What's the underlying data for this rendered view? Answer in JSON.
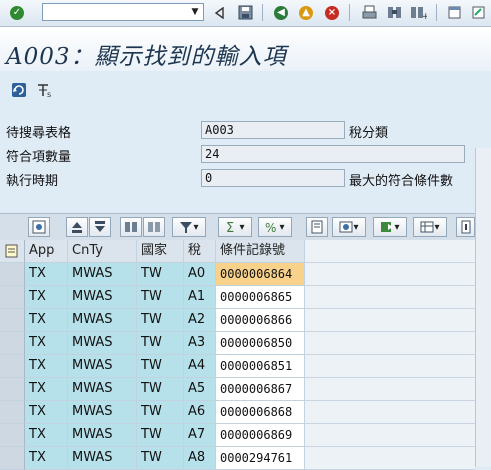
{
  "title": "A003：顯示找到的輸入項",
  "form": {
    "search_table_label": "待搜尋表格",
    "search_table_value": "A003",
    "search_table_desc": "稅分類",
    "hits_label": "符合項數量",
    "hits_value": "24",
    "exec_time_label": "執行時期",
    "exec_time_value": "0",
    "exec_time_desc": "最大的符合條件數"
  },
  "grid": {
    "headers": [
      "App",
      "CnTy",
      "國家",
      "稅",
      "條件記錄號"
    ],
    "rows": [
      [
        "TX",
        "MWAS",
        "TW",
        "A0",
        "0000006864"
      ],
      [
        "TX",
        "MWAS",
        "TW",
        "A1",
        "0000006865"
      ],
      [
        "TX",
        "MWAS",
        "TW",
        "A2",
        "0000006866"
      ],
      [
        "TX",
        "MWAS",
        "TW",
        "A3",
        "0000006850"
      ],
      [
        "TX",
        "MWAS",
        "TW",
        "A4",
        "0000006851"
      ],
      [
        "TX",
        "MWAS",
        "TW",
        "A5",
        "0000006867"
      ],
      [
        "TX",
        "MWAS",
        "TW",
        "A6",
        "0000006868"
      ],
      [
        "TX",
        "MWAS",
        "TW",
        "A7",
        "0000006869"
      ],
      [
        "TX",
        "MWAS",
        "TW",
        "A8",
        "0000294761"
      ]
    ]
  },
  "colors": {
    "key_cell": "#b7e1ea",
    "highlight_cell": "#f8d28b",
    "header": "#dbe4ec"
  },
  "icons": {
    "std_toolbar": [
      "enter-check-icon",
      "dropdown-arrow-icon",
      "command-field-collapse-icon",
      "save-icon",
      "back-icon",
      "exit-icon",
      "cancel-icon",
      "print-icon",
      "find-icon",
      "find-next-icon"
    ],
    "app_toolbar": [
      "refresh-icon",
      "technical-settings-icon"
    ]
  }
}
